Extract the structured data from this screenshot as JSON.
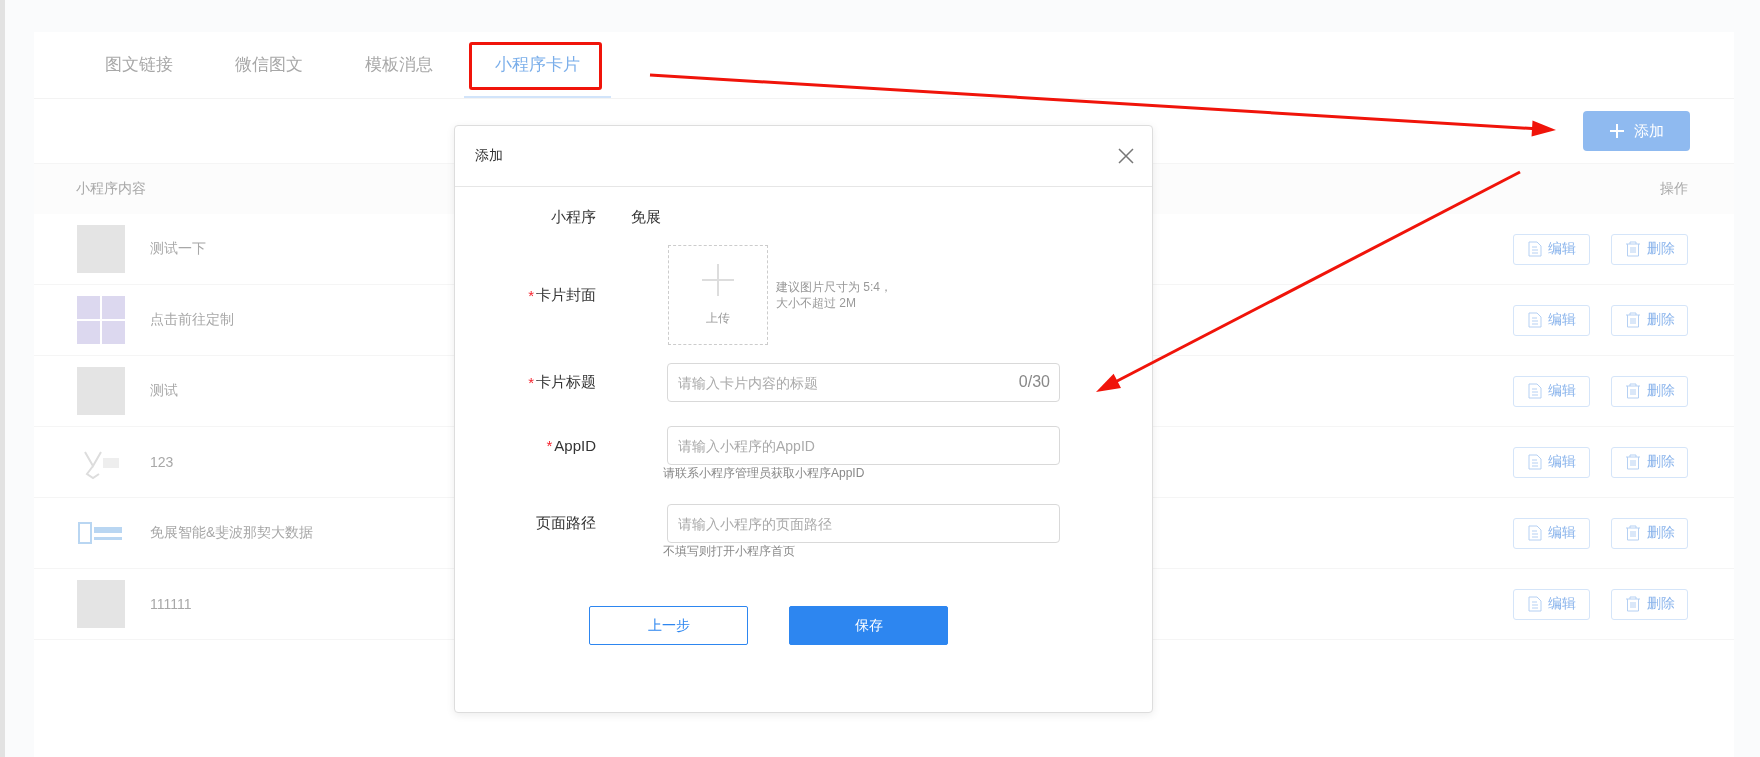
{
  "tabs": [
    {
      "label": "图文链接",
      "selected": false
    },
    {
      "label": "微信图文",
      "selected": false
    },
    {
      "label": "模板消息",
      "selected": false
    },
    {
      "label": "小程序卡片",
      "selected": true
    }
  ],
  "add_button": {
    "label": "添加"
  },
  "table": {
    "columns": [
      "小程序内容",
      "操作"
    ],
    "rows": [
      {
        "thumbnail": {
          "kind": "photo"
        },
        "title": "测试一下",
        "actions": [
          {
            "kind": "edit",
            "label": "编辑"
          },
          {
            "kind": "delete",
            "label": "删除"
          }
        ]
      },
      {
        "thumbnail": {
          "kind": "tile"
        },
        "title": "点击前往定制",
        "actions": [
          {
            "kind": "edit",
            "label": "编辑"
          },
          {
            "kind": "delete",
            "label": "删除"
          }
        ]
      },
      {
        "thumbnail": {
          "kind": "photo"
        },
        "title": "测试",
        "actions": [
          {
            "kind": "edit",
            "label": "编辑"
          },
          {
            "kind": "delete",
            "label": "删除"
          }
        ]
      },
      {
        "thumbnail": {
          "kind": "rabbit"
        },
        "title": "123",
        "actions": [
          {
            "kind": "edit",
            "label": "编辑"
          },
          {
            "kind": "delete",
            "label": "删除"
          }
        ]
      },
      {
        "thumbnail": {
          "kind": "emblem"
        },
        "title": "免展智能&斐波那契大数据",
        "actions": [
          {
            "kind": "edit",
            "label": "编辑"
          },
          {
            "kind": "delete",
            "label": "删除"
          }
        ]
      },
      {
        "thumbnail": {
          "kind": "photo"
        },
        "title": "111111",
        "actions": [
          {
            "kind": "edit",
            "label": "编辑"
          },
          {
            "kind": "delete",
            "label": "删除"
          }
        ]
      }
    ]
  },
  "dialog": {
    "title": "添加",
    "fields": [
      {
        "kind": "static",
        "label": "小程序",
        "value": "免展"
      },
      {
        "kind": "upload",
        "required_mark": "*",
        "label": "卡片封面",
        "button": "上传",
        "hint_lines": [
          "建议图片尺寸为 5:4，",
          "大小不超过 2M"
        ]
      },
      {
        "kind": "input",
        "required_mark": "*",
        "label": "卡片标题",
        "placeholder": "请输入卡片内容的标题",
        "counter": "0/30"
      },
      {
        "kind": "input",
        "required_mark": "*",
        "label": "AppID",
        "placeholder": "请输入小程序的AppID",
        "help": "请联系小程序管理员获取小程序AppID"
      },
      {
        "kind": "input",
        "label": "页面路径",
        "placeholder": "请输入小程序的页面路径",
        "help": "不填写则打开小程序首页"
      }
    ],
    "buttons": [
      {
        "kind": "secondary",
        "label": "上一步"
      },
      {
        "kind": "primary",
        "label": "保存"
      }
    ]
  },
  "annotations": [
    {
      "kind": "highlight-box"
    },
    {
      "kind": "arrow"
    },
    {
      "kind": "arrow"
    }
  ]
}
